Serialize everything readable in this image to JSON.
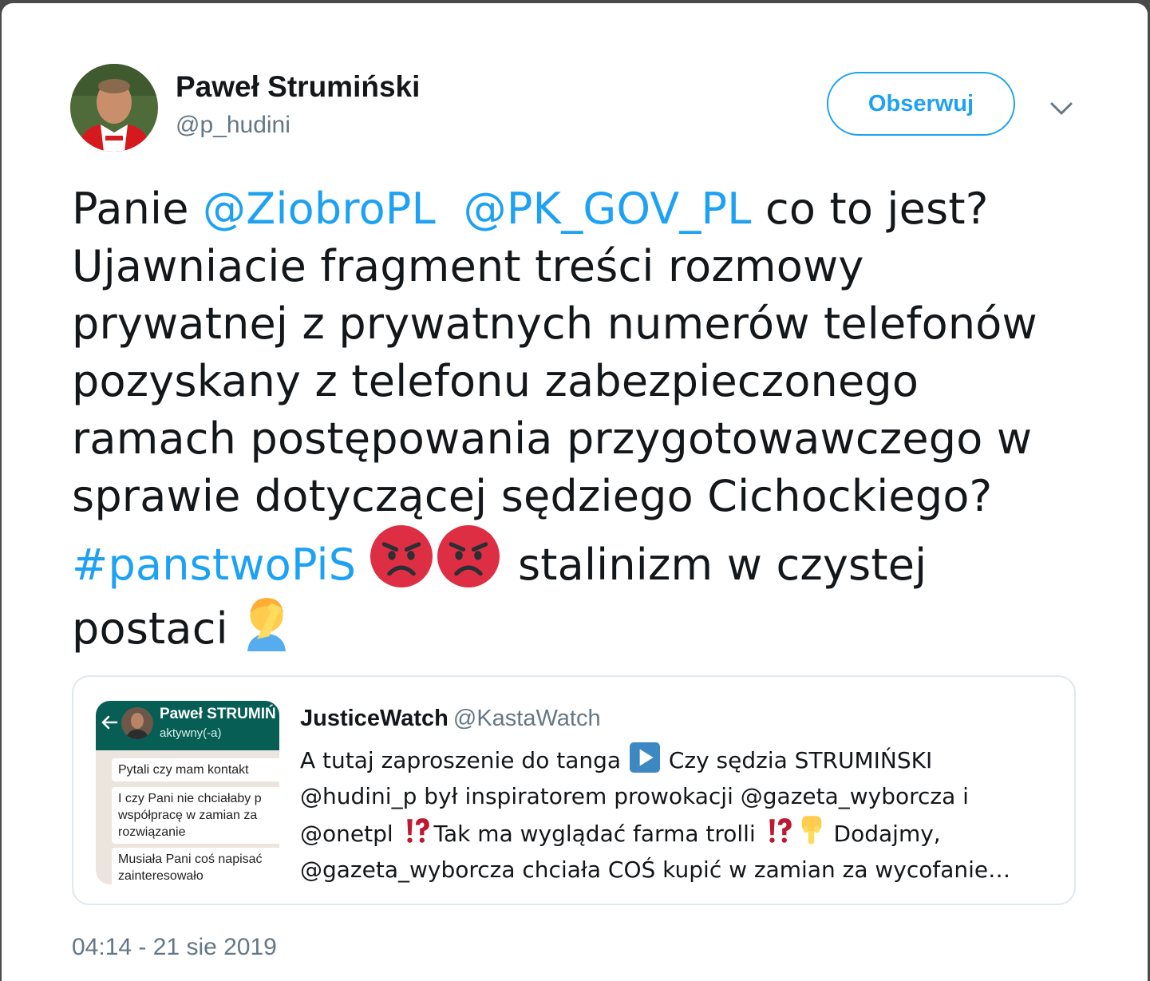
{
  "author": {
    "name": "Paweł Strumiński",
    "handle": "@p_hudini"
  },
  "follow_button": {
    "label": "Obserwuj"
  },
  "colors": {
    "link": "#1da1f2",
    "text": "#14171a",
    "muted": "#657786",
    "border": "#e1e8ed"
  },
  "tweet": {
    "line1": {
      "a": "Panie ",
      "mention1": "@ZiobroPL",
      "sep": " ",
      "mention2": "@PK_GOV_PL",
      "b": " co to jest?"
    },
    "line2": "Ujawniacie fragment treści rozmowy",
    "line3": "prywatnej z prywatnych numerów telefonów",
    "line4": "pozyskany z telefonu zabezpieczonego",
    "line5": "ramach postępowania przygotowawczego w",
    "line6": "sprawie dotyczącej sędziego Cichockiego?",
    "line7": {
      "hashtag": "#panstwoPiS",
      "emojis": [
        "angry-face-icon",
        "angry-face-icon"
      ],
      "b": "stalinizm w czystej"
    },
    "line8": {
      "a": "postaci",
      "emoji": "facepalm-icon"
    }
  },
  "quoted_tweet": {
    "name": "JusticeWatch",
    "handle": "@KastaWatch",
    "line1": {
      "a": "A tutaj zaproszenie do tanga ",
      "emoji": "play-button-icon",
      "b": " Czy sędzia STRUMIŃSKI"
    },
    "line2": "@hudini_p był inspiratorem prowokacji @gazeta_wyborcza i",
    "line3": {
      "a": "@onetpl ",
      "emoji1": "exclamation-question-icon",
      "b": "Tak ma wyglądać farma trolli ",
      "emoji2": "exclamation-question-icon",
      "emoji3": "pointing-down-icon",
      "c": " Dodajmy,"
    },
    "line4": "@gazeta_wyborcza chciała COŚ kupić w zamian za wycofanie…",
    "thumbnail": {
      "contact": "Paweł STRUMIŃ",
      "status": "aktywny(-a)",
      "messages": [
        "Pytali czy mam kontakt",
        "I czy Pani nie chciałaby p\nwspółpracę w zamian za\nrozwiązanie",
        "Musiała Pani coś napisać\nzainteresowało"
      ]
    }
  },
  "timestamp": "04:14 - 21 sie 2019"
}
